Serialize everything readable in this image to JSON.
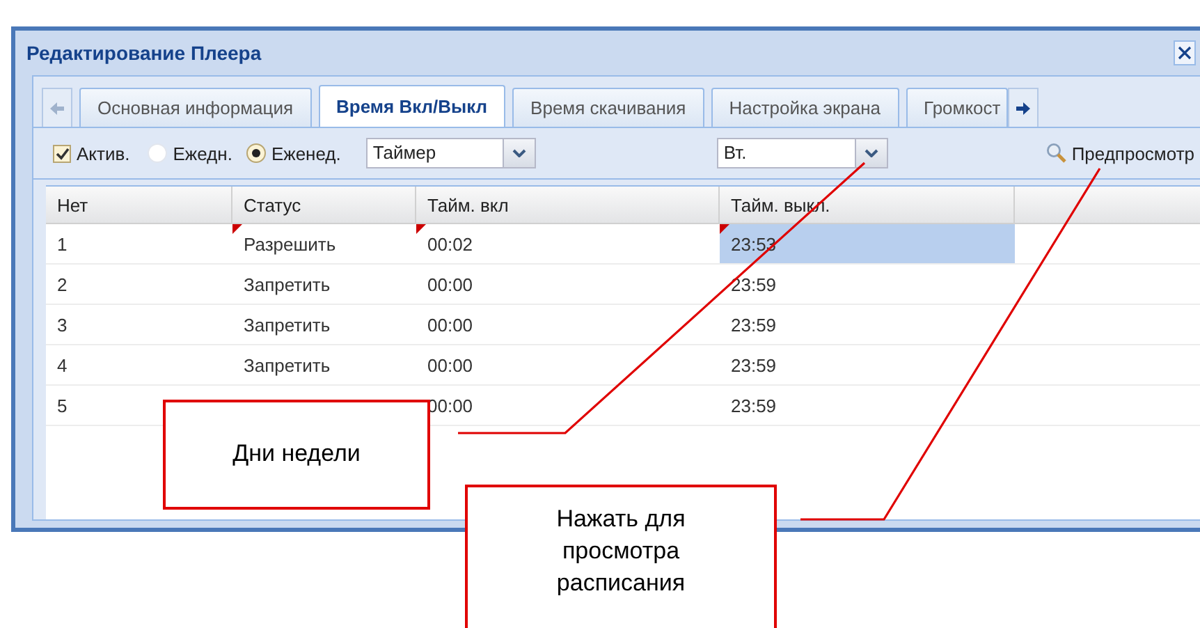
{
  "window": {
    "title": "Редактирование Плеера"
  },
  "tabs": [
    {
      "label": "Основная информация",
      "selected": false
    },
    {
      "label": "Время Вкл/Выкл",
      "selected": true
    },
    {
      "label": "Время скачивания",
      "selected": false
    },
    {
      "label": "Настройка экрана",
      "selected": false
    },
    {
      "label": "Громкост",
      "selected": false
    }
  ],
  "toolbar": {
    "active": {
      "label": "Актив.",
      "checked": true
    },
    "repeat": [
      {
        "label": "Ежедн.",
        "selected": false
      },
      {
        "label": "Еженед.",
        "selected": true
      }
    ],
    "mode": {
      "value": "Таймер"
    },
    "day": {
      "value": "Вт."
    },
    "preview": {
      "label": "Предпросмотр"
    }
  },
  "table": {
    "columns": [
      "Нет",
      "Статус",
      "Тайм. вкл",
      "Тайм. выкл."
    ],
    "rows": [
      {
        "cells": [
          "1",
          "Разрешить",
          "00:02",
          "23:53"
        ],
        "modified": true,
        "selected": true
      },
      {
        "cells": [
          "2",
          "Запретить",
          "00:00",
          "23:59"
        ],
        "modified": false,
        "selected": false
      },
      {
        "cells": [
          "3",
          "Запретить",
          "00:00",
          "23:59"
        ],
        "modified": false,
        "selected": false
      },
      {
        "cells": [
          "4",
          "Запретить",
          "00:00",
          "23:59"
        ],
        "modified": false,
        "selected": false
      },
      {
        "cells": [
          "5",
          "",
          "00:00",
          "23:59"
        ],
        "modified": false,
        "selected": false
      }
    ]
  },
  "callouts": [
    {
      "text": "Дни недели"
    },
    {
      "text": "Нажать для просмотра расписания"
    }
  ]
}
